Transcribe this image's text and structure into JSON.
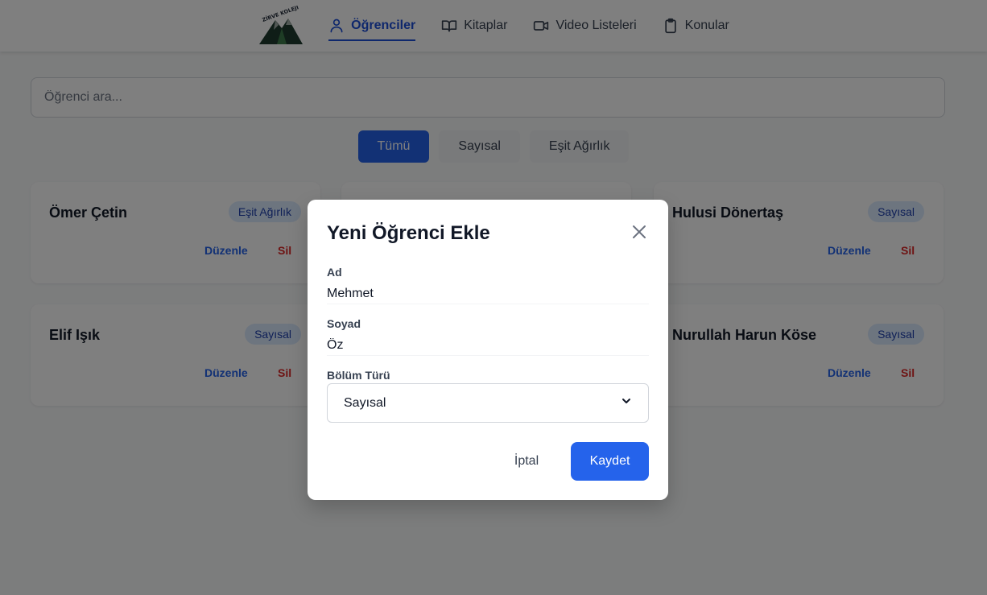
{
  "nav": {
    "logo_text": "ZİRVE KOLEJİ",
    "items": [
      {
        "label": "Öğrenciler",
        "icon": "user-icon",
        "active": true
      },
      {
        "label": "Kitaplar",
        "icon": "book-icon",
        "active": false
      },
      {
        "label": "Video Listeleri",
        "icon": "video-icon",
        "active": false
      },
      {
        "label": "Konular",
        "icon": "clipboard-icon",
        "active": false
      }
    ]
  },
  "search": {
    "placeholder": "Öğrenci ara...",
    "value": ""
  },
  "filters": [
    {
      "label": "Tümü",
      "active": true
    },
    {
      "label": "Sayısal",
      "active": false
    },
    {
      "label": "Eşit Ağırlık",
      "active": false
    }
  ],
  "students": [
    {
      "name": "Ömer Çetin",
      "badge": "Eşit Ağırlık",
      "edit": "Düzenle",
      "delete": "Sil"
    },
    {
      "name": "Hulusi Dönertaş",
      "badge": "Sayısal",
      "edit": "Düzenle",
      "delete": "Sil"
    },
    {
      "name": "Elif Işık",
      "badge": "Sayısal",
      "edit": "Düzenle",
      "delete": "Sil"
    },
    {
      "name": "Nurullah Harun Köse",
      "badge": "Sayısal",
      "edit": "Düzenle",
      "delete": "Sil"
    }
  ],
  "modal": {
    "title": "Yeni Öğrenci Ekle",
    "first_name_label": "Ad",
    "first_name_value": "Mehmet",
    "last_name_label": "Soyad",
    "last_name_value": "Öz",
    "department_label": "Bölüm Türü",
    "department_value": "Sayısal",
    "cancel_label": "İptal",
    "save_label": "Kaydet"
  },
  "colors": {
    "accent": "#2563eb",
    "danger": "#dc2626",
    "badge_bg": "#dbeafe",
    "overlay": "rgba(0,0,0,0.5)"
  }
}
